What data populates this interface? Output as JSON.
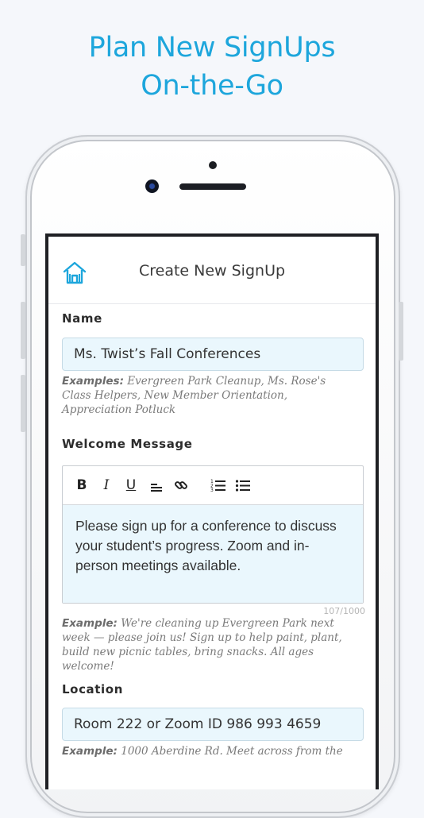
{
  "headline": {
    "line1": "Plan New SignUps",
    "line2": "On-the-Go"
  },
  "header": {
    "title": "Create New SignUp",
    "home_icon": "home-icon"
  },
  "form": {
    "name_label": "Name",
    "name_value": "Ms. Twist’s Fall Conferences",
    "name_hint_prefix": "Examples:",
    "name_hint": "Evergreen Park Cleanup, Ms. Rose's Class Helpers, New Member Orientation, Appreciation Potluck",
    "welcome_label": "Welcome Message",
    "toolbar": [
      "bold-icon",
      "italic-icon",
      "underline-icon",
      "align-icon",
      "link-icon",
      "ordered-list-icon",
      "bullet-list-icon"
    ],
    "welcome_value": "Please sign up for a conference to discuss your student’s progress. Zoom and in-person meetings available.",
    "welcome_counter": "107/1000",
    "welcome_hint_prefix": "Example:",
    "welcome_hint": "We're cleaning up Evergreen Park next week — please join us! Sign up to help paint, plant, build new picnic tables, bring snacks. All ages welcome!",
    "location_label": "Location",
    "location_value": "Room 222 or Zoom ID 986 993 4659",
    "location_hint_prefix": "Example:",
    "location_hint": "1000 Aberdine Rd. Meet across from the"
  },
  "colors": {
    "accent": "#1da6dc",
    "field_bg": "#eaf7fd"
  }
}
